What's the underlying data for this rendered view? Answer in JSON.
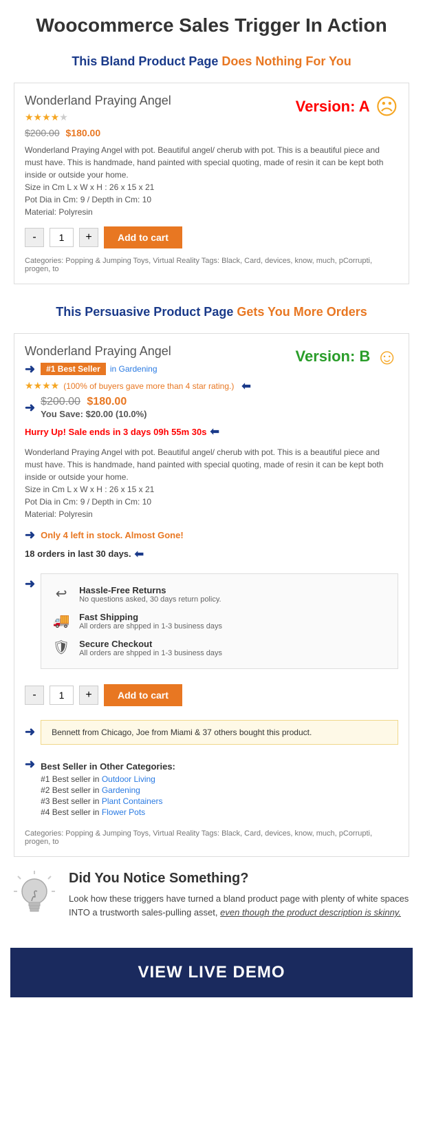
{
  "page": {
    "title": "Woocommerce Sales Trigger In Action"
  },
  "version_a": {
    "section_heading_blue": "This Bland Product Page",
    "section_heading_orange": "Does Nothing For You",
    "version_label": "Version: A",
    "product_title": "Wonderland Praying Angel",
    "stars_filled": 4,
    "stars_empty": 1,
    "price_original": "$200.00",
    "price_sale": "$180.00",
    "description": "Wonderland Praying Angel with pot. Beautiful angel/ cherub with pot. This is a beautiful piece and must have. This is handmade, hand painted with special quoting, made of resin it can be kept both inside or outside your home.\nSize in Cm L x W x H : 26 x 15 x 21\nPot Dia in Cm: 9 / Depth in Cm: 10\nMaterial: Polyresin",
    "qty_value": "1",
    "add_to_cart_label": "Add to cart",
    "categories_text": "Categories: Popping & Jumping Toys, Virtual Reality Tags: Black, Card, devices, know, much, pCorrupti, progen, to"
  },
  "version_b": {
    "section_heading_blue": "This Persuasive Product Page",
    "section_heading_orange": "Gets You More Orders",
    "version_label": "Version: B",
    "product_title": "Wonderland Praying Angel",
    "best_seller_label": "#1 Best Seller",
    "best_seller_category": "in Gardening",
    "stars_filled": 4,
    "rating_text": "(100% of buyers gave more than 4 star rating.)",
    "price_original": "$200.00",
    "price_sale": "$180.00",
    "you_save": "You Save: $20.00 (10.0%)",
    "hurry_up": "Hurry Up! Sale ends in 3 days 09h 55m 30s",
    "description": "Wonderland Praying Angel with pot. Beautiful angel/ cherub with pot. This is a beautiful piece and must have. This is handmade, hand painted with special quoting, made of resin it can be kept both inside or outside your home.\nSize in Cm L x W x H : 26 x 15 x 21\nPot Dia in Cm: 9 / Depth in Cm: 10\nMaterial: Polyresin",
    "stock_text": "Only 4 left in stock. Almost Gone!",
    "orders_text": "18 orders in last 30 days.",
    "trust": [
      {
        "icon": "↩",
        "label": "Hassle-Free Returns",
        "desc": "No questions asked, 30 days return policy."
      },
      {
        "icon": "🚚",
        "label": "Fast Shipping",
        "desc": "All orders are shpped in 1-3 business days"
      },
      {
        "icon": "🛡",
        "label": "Secure Checkout",
        "desc": "All orders are shpped in 1-3 business days"
      }
    ],
    "qty_value": "1",
    "add_to_cart_label": "Add to cart",
    "recent_buyers": "Bennett from Chicago, Joe from Miami & 37 others bought this product.",
    "best_seller_title": "Best Seller in Other Categories:",
    "best_sellers": [
      {
        "rank": "#1",
        "label": "Best seller in",
        "category": "Outdoor Living"
      },
      {
        "rank": "#2",
        "label": "Best seller in",
        "category": "Gardening"
      },
      {
        "rank": "#3",
        "label": "Best seller in",
        "category": "Plant Containers"
      },
      {
        "rank": "#4",
        "label": "Best seller in",
        "category": "Flower Pots"
      }
    ],
    "categories_text": "Categories: Popping & Jumping Toys, Virtual Reality Tags: Black, Card, devices, know, much, pCorrupti, progen, to"
  },
  "notice": {
    "heading": "Did You Notice Something?",
    "text": "Look how these triggers have turned a bland product page with plenty of white spaces INTO a trustworth sales-pulling asset,",
    "italic_text": "even though the product description is skinny."
  },
  "cta": {
    "label": "VIEW LIVE DEMO"
  }
}
